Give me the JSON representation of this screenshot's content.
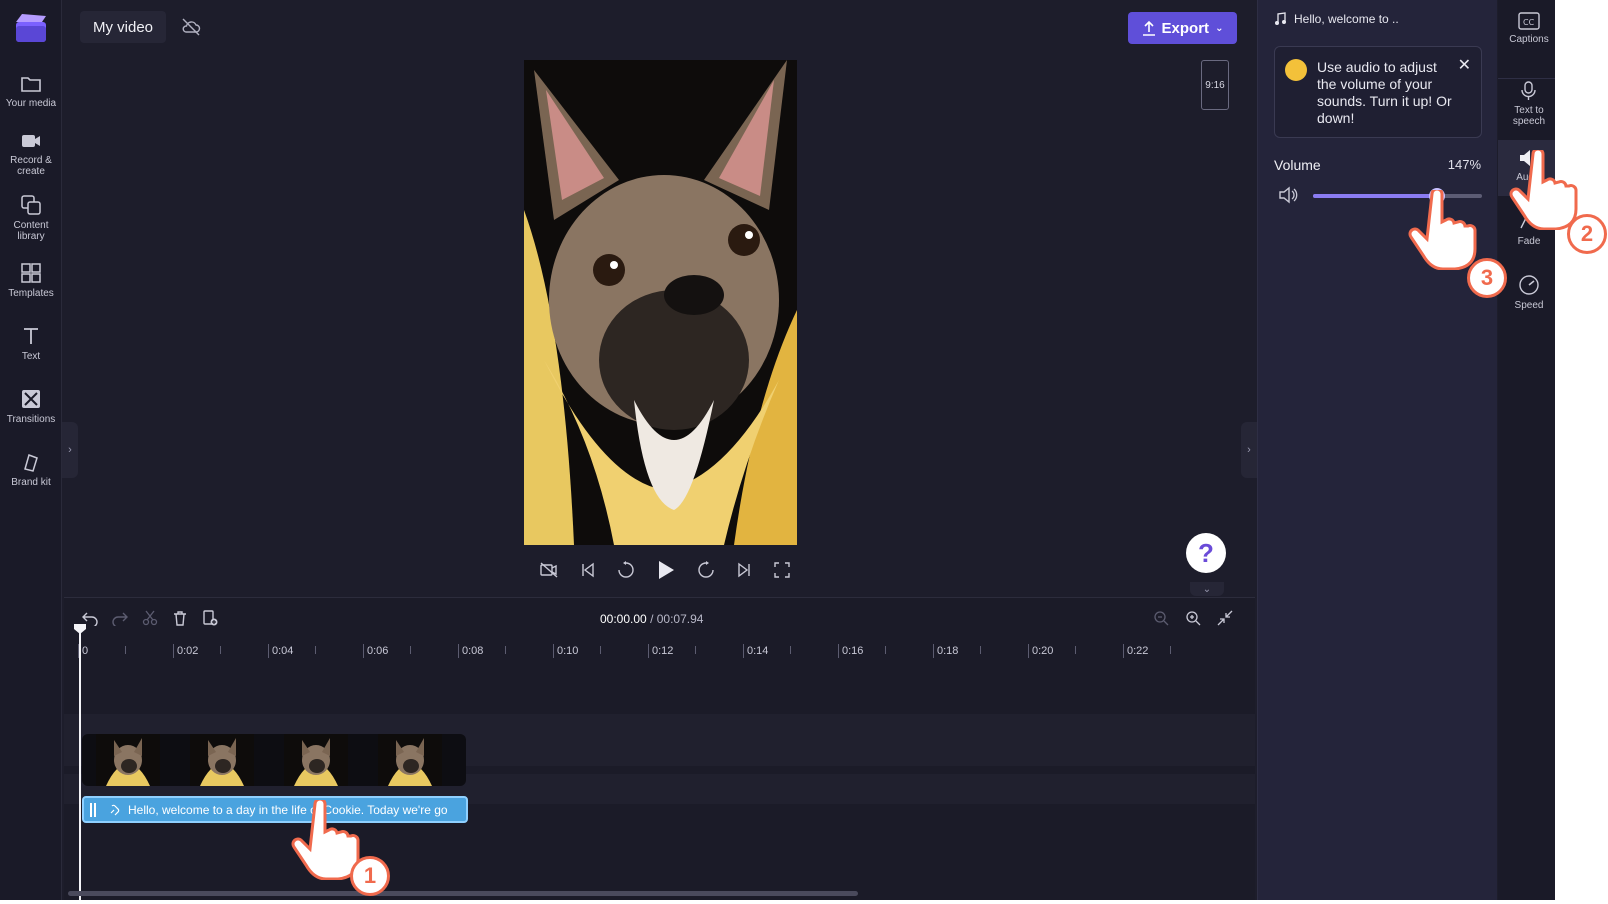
{
  "project": {
    "title": "My video"
  },
  "toolbar": {
    "export_label": "Export"
  },
  "left_nav": [
    {
      "label": "Your media",
      "icon": "folder-icon"
    },
    {
      "label": "Record &\ncreate",
      "icon": "camera-icon"
    },
    {
      "label": "Content\nlibrary",
      "icon": "library-icon"
    },
    {
      "label": "Templates",
      "icon": "templates-icon"
    },
    {
      "label": "Text",
      "icon": "text-icon"
    },
    {
      "label": "Transitions",
      "icon": "transitions-icon"
    },
    {
      "label": "Brand kit",
      "icon": "brand-kit-icon"
    }
  ],
  "preview": {
    "aspect_ratio": "9:16"
  },
  "help": {
    "label": "?"
  },
  "timeline": {
    "current_time": "00:00.00",
    "duration": "/ 00:07.94",
    "ruler_labels": [
      "0",
      "0:02",
      "0:04",
      "0:06",
      "0:08",
      "0:10",
      "0:12",
      "0:14",
      "0:16",
      "0:18",
      "0:20",
      "0:22"
    ],
    "audio_clip_label": "Hello, welcome to a day in the life of Cookie. Today we're go"
  },
  "properties": {
    "clip_name": "Hello, welcome to ..",
    "tip_text": "Use audio to adjust the volume of your sounds. Turn it up! Or down!",
    "volume_label": "Volume",
    "volume_value": "147%",
    "volume_fraction": 0.735
  },
  "right_rail": [
    {
      "label": "Captions",
      "icon": "captions-icon"
    },
    {
      "label": "Text to\nspeech",
      "icon": "text-to-speech-icon"
    },
    {
      "label": "Audio",
      "icon": "audio-icon"
    },
    {
      "label": "Fade",
      "icon": "fade-icon"
    },
    {
      "label": "Speed",
      "icon": "speed-icon"
    }
  ],
  "annotations": {
    "step1": "1",
    "step2": "2",
    "step3": "3"
  },
  "colors": {
    "accent": "#5f4fd9",
    "audio_clip": "#4aa3df",
    "annotation": "#f06a4d"
  }
}
